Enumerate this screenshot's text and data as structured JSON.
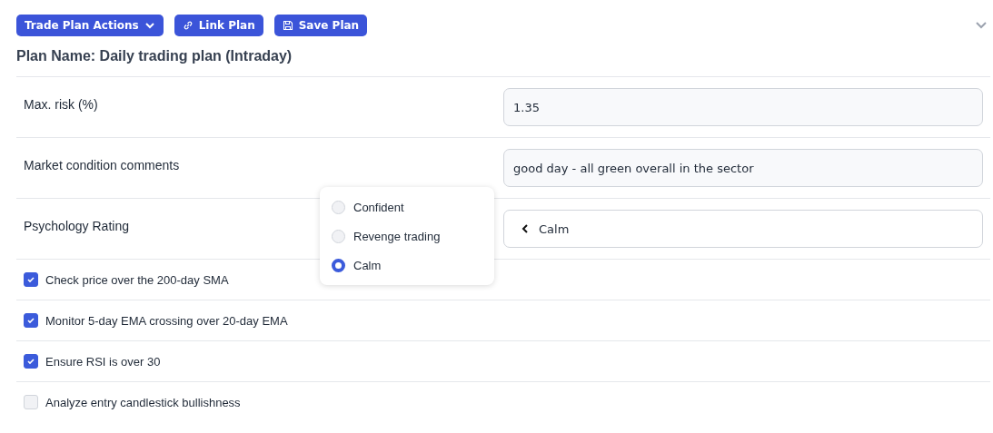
{
  "toolbar": [
    {
      "kind": "menu",
      "label": "Trade Plan Actions"
    },
    {
      "kind": "link",
      "label": "Link Plan"
    },
    {
      "kind": "save",
      "label": "Save Plan"
    }
  ],
  "plan_title": "Plan Name: Daily trading plan (Intraday)",
  "fields": [
    {
      "label": "Max. risk (%)",
      "kind": "input",
      "value": "1.35"
    },
    {
      "label": "Market condition comments",
      "kind": "input",
      "value": "good day - all green overall in the sector"
    },
    {
      "label": "Psychology Rating",
      "kind": "select",
      "value": "Calm",
      "expanded": true,
      "options": [
        {
          "label": "Confident",
          "selected": false
        },
        {
          "label": "Revenge trading",
          "selected": false
        },
        {
          "label": "Calm",
          "selected": true
        }
      ]
    }
  ],
  "checklist": [
    {
      "label": "Check price over the 200-day SMA",
      "checked": true
    },
    {
      "label": "Monitor 5-day EMA crossing over 20-day EMA",
      "checked": true
    },
    {
      "label": "Ensure RSI is over 30",
      "checked": true
    },
    {
      "label": "Analyze entry candlestick bullishness",
      "checked": false
    }
  ]
}
